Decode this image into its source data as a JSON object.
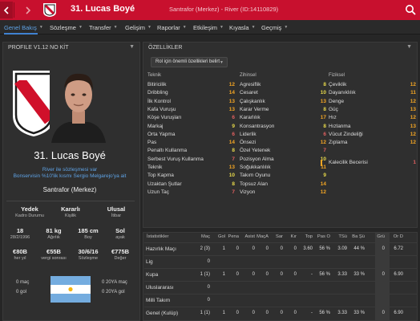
{
  "header": {
    "back_icon": "chevron-left-icon",
    "forward_icon": "chevron-right-icon",
    "player_name": "31. Lucas Boyé",
    "subtitle": "Santrafor (Merkez) - River (ID:14110829)",
    "search_icon": "search-icon",
    "bg_color": "#c8102e"
  },
  "tabs": [
    {
      "label": "Genel Bakış",
      "has_caret": true
    },
    {
      "label": "Sözleşme",
      "has_caret": true
    },
    {
      "label": "Transfer",
      "has_caret": true
    },
    {
      "label": "Gelişim",
      "has_caret": true
    },
    {
      "label": "Raporlar",
      "has_caret": true
    },
    {
      "label": "Etkileşim",
      "has_caret": true
    },
    {
      "label": "Kıyasla",
      "has_caret": true
    },
    {
      "label": "Geçmiş",
      "has_caret": true
    }
  ],
  "profile": {
    "title": "PROFILE V1.12 NO KİT",
    "name": "31. Lucas Boyé",
    "contract_line1": "River ile sözleşmesi var",
    "contract_line2": "Bonservisin %10'lik kısmı Sergio Melgarejo'ya ait",
    "position": "Santrafor (Merkez)",
    "info": [
      {
        "value": "Yedek",
        "label": "Kadro Durumu"
      },
      {
        "value": "Kararlı",
        "label": "Kişilik"
      },
      {
        "value": "Ulusal",
        "label": "İtibar"
      }
    ],
    "stats": [
      {
        "value": "18",
        "label": "28/2/1996"
      },
      {
        "value": "81 kg",
        "label": "Ağırlık"
      },
      {
        "value": "185 cm",
        "label": "Boy"
      },
      {
        "value": "Sol",
        "label": "ayak"
      }
    ],
    "money": [
      {
        "value": "€80B",
        "label": "her yıl"
      },
      {
        "value": "€55B",
        "label": "vergi sonrası"
      },
      {
        "value": "30/6/16",
        "label": "Sözleşme"
      },
      {
        "value": "€775B",
        "label": "Değer"
      }
    ],
    "caps_left": [
      {
        "value": "0 maç"
      },
      {
        "value": "0 gol"
      }
    ],
    "caps_right": [
      {
        "value": "0 20YA maç"
      },
      {
        "value": "0 20YA gol"
      }
    ]
  },
  "attributes": {
    "title": "ÖZELLİKLER",
    "dropdown": "Rol için önemli özellikleri belirt",
    "technical_head": "Teknik",
    "mental_head": "Zihinsel",
    "physical_head": "Fiziksel",
    "technical": [
      {
        "name": "Bitiricilik",
        "value": "12"
      },
      {
        "name": "Dribbling",
        "value": "14"
      },
      {
        "name": "İlk Kontrol",
        "value": "13"
      },
      {
        "name": "Kafa Vuruşu",
        "value": "13"
      },
      {
        "name": "Köşe Vuruşları",
        "value": "6"
      },
      {
        "name": "Markaj",
        "value": "9"
      },
      {
        "name": "Orta Yapma",
        "value": "6"
      },
      {
        "name": "Pas",
        "value": "14"
      },
      {
        "name": "Penaltı Kullanma",
        "value": "8"
      },
      {
        "name": "Serbest Vuruş Kullanma",
        "value": "7"
      },
      {
        "name": "Teknik",
        "value": "13"
      },
      {
        "name": "Top Kapma",
        "value": "10"
      },
      {
        "name": "Uzaktan Şutlar",
        "value": "8"
      },
      {
        "name": "Uzun Taç",
        "value": "7"
      }
    ],
    "mental": [
      {
        "name": "Agresiflik",
        "value": "8"
      },
      {
        "name": "Cesaret",
        "value": "10"
      },
      {
        "name": "Çalışkanlık",
        "value": "13"
      },
      {
        "name": "Karar Verme",
        "value": "8"
      },
      {
        "name": "Kararlılık",
        "value": "17"
      },
      {
        "name": "Konsantrasyon",
        "value": "8"
      },
      {
        "name": "Liderlik",
        "value": "6"
      },
      {
        "name": "Önsezi",
        "value": "12"
      },
      {
        "name": "Özel Yetenek",
        "value": "7"
      },
      {
        "name": "Pozisyon Alma",
        "value": "10"
      },
      {
        "name": "Soğukkanlılık",
        "value": "11"
      },
      {
        "name": "Takım Oyunu",
        "value": "9"
      },
      {
        "name": "Topsuz Alan",
        "value": "14"
      },
      {
        "name": "Vizyon",
        "value": "12"
      }
    ],
    "physical": [
      {
        "name": "Çeviklik",
        "value": "12"
      },
      {
        "name": "Dayanıklılık",
        "value": "11"
      },
      {
        "name": "Denge",
        "value": "12"
      },
      {
        "name": "Güç",
        "value": "13"
      },
      {
        "name": "Hız",
        "value": "12"
      },
      {
        "name": "Hızlanma",
        "value": "13"
      },
      {
        "name": "Vücut Zindeliği",
        "value": "12"
      },
      {
        "name": "Zıplama",
        "value": "12"
      }
    ],
    "special": "Kalecilik Becerisi",
    "special_value": "1",
    "colors": {
      "high": "#f5a623",
      "mid": "#e6d84a",
      "low": "#e06060",
      "red": "#d8382c"
    }
  },
  "stats_table": {
    "title": "İstatistikler",
    "columns": [
      "Maç",
      "Gol",
      "Pena",
      "Asist",
      "MaçA",
      "Sar",
      "Kır",
      "Top",
      "Pas O",
      "TSü",
      "Ba Şü",
      "Grü",
      "Or D"
    ],
    "rows": [
      {
        "label": "Hazırlık Maçı",
        "cells": [
          "2 (3)",
          "1",
          "0",
          "0",
          "0",
          "0",
          "0",
          "3.60",
          "56 %",
          "3.09",
          "44 %",
          "0",
          "6.72"
        ]
      },
      {
        "label": "Lig",
        "cells": [
          "0",
          "",
          "",
          "",
          "",
          "",
          "",
          "",
          "",
          "",
          "",
          "",
          ""
        ]
      },
      {
        "label": "Kupa",
        "cells": [
          "1 (1)",
          "1",
          "0",
          "0",
          "0",
          "0",
          "0",
          "-",
          "56 %",
          "3.33",
          "33 %",
          "0",
          "6.90"
        ]
      },
      {
        "label": "Uluslararası",
        "cells": [
          "0",
          "",
          "",
          "",
          "",
          "",
          "",
          "",
          "",
          "",
          "",
          "",
          ""
        ]
      },
      {
        "label": "Milli Takım",
        "cells": [
          "0",
          "",
          "",
          "",
          "",
          "",
          "",
          "",
          "",
          "",
          "",
          "",
          ""
        ]
      },
      {
        "label": "Genel (Kulüp)",
        "cells": [
          "1 (1)",
          "1",
          "0",
          "0",
          "0",
          "0",
          "0",
          "-",
          "56 %",
          "3.33",
          "33 %",
          "0",
          "6.90"
        ]
      }
    ]
  }
}
